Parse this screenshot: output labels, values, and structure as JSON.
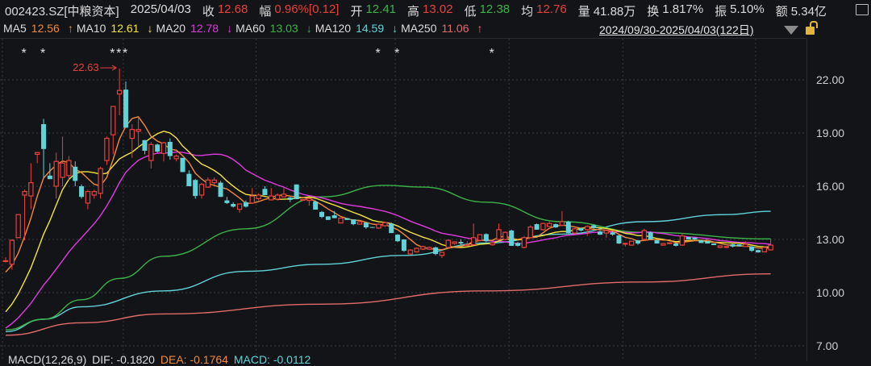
{
  "header": {
    "symbol": "002423.SZ[中粮资本]",
    "date": "2025/04/03",
    "fields": [
      {
        "label": "收",
        "value": "12.68",
        "color": "red"
      },
      {
        "label": "幅",
        "value": "0.96%[0.12]",
        "color": "red"
      },
      {
        "label": "开",
        "value": "12.41",
        "color": "green"
      },
      {
        "label": "高",
        "value": "13.02",
        "color": "red"
      },
      {
        "label": "低",
        "value": "12.38",
        "color": "green"
      },
      {
        "label": "均",
        "value": "12.76",
        "color": "red"
      },
      {
        "label": "量",
        "value": "41.88万",
        "color": "white"
      },
      {
        "label": "换",
        "value": "1.817%",
        "color": "white"
      },
      {
        "label": "振",
        "value": "5.10%",
        "color": "white"
      },
      {
        "label": "额",
        "value": "5.34亿",
        "color": "white"
      }
    ]
  },
  "ma_legend": [
    {
      "label": "MA5",
      "value": "12.56",
      "arrow": "↑",
      "color": "#f08a3c",
      "arrow_color": "#f08a3c"
    },
    {
      "label": "MA10",
      "value": "12.61",
      "arrow": "↓",
      "color": "#f2e43a",
      "arrow_color": "#f2e43a"
    },
    {
      "label": "MA20",
      "value": "12.78",
      "arrow": "↓",
      "color": "#e03ae0",
      "arrow_color": "#e03ae0"
    },
    {
      "label": "MA60",
      "value": "13.03",
      "arrow": "↓",
      "color": "#3cb34a",
      "arrow_color": "#3cb34a"
    },
    {
      "label": "MA120",
      "value": "14.59",
      "arrow": "↓",
      "color": "#5fd3d8",
      "arrow_color": "#5fd3d8"
    },
    {
      "label": "MA250",
      "value": "11.06",
      "arrow": "↑",
      "color": "#e26b6b",
      "arrow_color": "#e26b6b"
    }
  ],
  "date_range": "2024/09/30-2025/04/03(122日)",
  "icons": {
    "dropdown": "triangle-down-icon",
    "lock": "lock-icon",
    "monitor": "monitor-icon"
  },
  "colors": {
    "up": "#e8413b",
    "down": "#5fd3d8",
    "background": "#131418",
    "grid": "#3a3b40",
    "axis_text": "#cfcfcf"
  },
  "macd": {
    "label": "MACD(12,26,9)",
    "dif": "DIF: -0.1820",
    "dea": "DEA: -0.1764",
    "macd": "MACD: -0.0112"
  },
  "chart_data": {
    "type": "candlestick",
    "ylim": [
      7,
      23.5
    ],
    "yticks": [
      "22.00",
      "19.00",
      "16.00",
      "13.00",
      "10.00",
      "7.00"
    ],
    "ytick_values": [
      22,
      19,
      16,
      13,
      10,
      7
    ],
    "max_label": "22.63",
    "max_index": 18,
    "marker_indices": [
      3,
      6,
      17,
      18,
      19,
      59,
      62,
      77
    ],
    "marker_symbol": "*",
    "month_boundary_indices": [
      19,
      40,
      62,
      80,
      98,
      119
    ],
    "ohlc": [
      [
        11.8,
        12.0,
        11.7,
        11.8
      ],
      [
        11.6,
        13.0,
        11.3,
        12.95
      ],
      [
        13.1,
        14.4,
        13.1,
        14.4
      ],
      [
        15.5,
        15.8,
        12.95,
        15.7
      ],
      [
        15.45,
        17.3,
        14.7,
        16.2
      ],
      [
        17.8,
        17.9,
        17.3,
        17.9
      ],
      [
        19.5,
        19.8,
        16.5,
        18.1
      ],
      [
        16.6,
        17.3,
        16.4,
        16.4
      ],
      [
        16.0,
        17.9,
        15.3,
        17.4
      ],
      [
        16.5,
        18.8,
        16.0,
        17.3
      ],
      [
        16.6,
        17.7,
        16.3,
        17.45
      ],
      [
        17.1,
        17.4,
        16.0,
        16.3
      ],
      [
        16.0,
        16.1,
        15.3,
        15.4
      ],
      [
        15.05,
        15.8,
        14.7,
        15.7
      ],
      [
        15.5,
        15.8,
        15.3,
        15.7
      ],
      [
        15.6,
        17.1,
        15.3,
        17.0
      ],
      [
        17.45,
        18.8,
        17.2,
        18.7
      ],
      [
        18.9,
        20.5,
        17.8,
        20.5
      ],
      [
        21.2,
        22.63,
        20.0,
        21.4
      ],
      [
        21.45,
        21.9,
        19.3,
        19.3
      ],
      [
        18.7,
        19.5,
        17.6,
        19.2
      ],
      [
        19.1,
        19.9,
        18.2,
        19.2
      ],
      [
        18.6,
        18.6,
        17.8,
        18.0
      ],
      [
        17.45,
        18.5,
        17.0,
        18.35
      ],
      [
        18.35,
        18.4,
        17.9,
        17.95
      ],
      [
        17.85,
        18.5,
        17.4,
        18.45
      ],
      [
        18.5,
        18.7,
        17.5,
        17.7
      ],
      [
        17.55,
        17.8,
        17.4,
        17.7
      ],
      [
        17.6,
        17.6,
        16.8,
        16.8
      ],
      [
        16.7,
        16.9,
        16.0,
        16.0
      ],
      [
        16.35,
        16.4,
        15.3,
        15.45
      ],
      [
        15.5,
        16.2,
        15.3,
        16.1
      ],
      [
        15.95,
        16.5,
        15.9,
        16.35
      ],
      [
        16.2,
        16.5,
        16.1,
        16.35
      ],
      [
        16.2,
        16.3,
        15.4,
        15.4
      ],
      [
        15.2,
        15.4,
        15.0,
        15.05
      ],
      [
        15.0,
        15.1,
        14.8,
        14.85
      ],
      [
        14.7,
        15.0,
        14.5,
        15.0
      ],
      [
        15.1,
        15.2,
        14.8,
        14.85
      ],
      [
        15.05,
        15.9,
        15.0,
        15.45
      ],
      [
        15.3,
        15.6,
        15.2,
        15.5
      ],
      [
        15.85,
        16.0,
        15.5,
        15.5
      ],
      [
        15.23,
        15.9,
        15.2,
        15.45
      ],
      [
        15.27,
        15.6,
        15.2,
        15.5
      ],
      [
        15.4,
        15.9,
        15.4,
        15.55
      ],
      [
        15.36,
        15.4,
        15.1,
        15.23
      ],
      [
        16.1,
        16.1,
        15.27,
        15.27
      ],
      [
        15.23,
        15.25,
        15.2,
        15.25
      ],
      [
        15.2,
        15.3,
        14.9,
        15.3
      ],
      [
        15.14,
        15.2,
        14.68,
        14.68
      ],
      [
        14.55,
        14.6,
        14.2,
        14.27
      ],
      [
        14.3,
        14.3,
        14.1,
        14.1
      ],
      [
        14.36,
        14.6,
        14.2,
        14.2
      ],
      [
        13.93,
        14.2,
        13.93,
        14.2
      ],
      [
        14.2,
        14.2,
        14.1,
        14.1
      ],
      [
        14.13,
        14.13,
        13.8,
        13.86
      ],
      [
        13.86,
        14.0,
        13.86,
        14.0
      ],
      [
        13.95,
        13.95,
        13.6,
        13.68
      ],
      [
        13.7,
        13.7,
        13.65,
        13.68
      ],
      [
        13.64,
        13.9,
        13.6,
        13.86
      ],
      [
        13.77,
        14.0,
        13.7,
        13.95
      ],
      [
        13.9,
        13.95,
        13.36,
        13.36
      ],
      [
        13.27,
        13.3,
        12.85,
        12.9
      ],
      [
        13.0,
        13.0,
        12.3,
        12.36
      ],
      [
        12.18,
        12.45,
        12.15,
        12.4
      ],
      [
        12.3,
        12.55,
        12.25,
        12.5
      ],
      [
        12.45,
        12.65,
        12.4,
        12.6
      ],
      [
        12.45,
        12.6,
        12.4,
        12.55
      ],
      [
        12.55,
        12.6,
        12.1,
        12.18
      ],
      [
        12.1,
        12.3,
        11.95,
        12.27
      ],
      [
        12.55,
        13.0,
        12.5,
        12.95
      ],
      [
        12.77,
        12.9,
        12.7,
        12.86
      ],
      [
        12.86,
        13.0,
        12.7,
        12.77
      ],
      [
        12.68,
        12.9,
        12.6,
        12.7
      ],
      [
        12.7,
        13.9,
        12.65,
        13.1
      ],
      [
        12.95,
        13.3,
        12.9,
        13.27
      ],
      [
        13.3,
        13.35,
        12.85,
        12.9
      ],
      [
        12.7,
        12.85,
        12.65,
        12.8
      ],
      [
        13.0,
        13.9,
        12.95,
        13.55
      ],
      [
        13.0,
        13.45,
        12.95,
        13.4
      ],
      [
        13.5,
        13.55,
        12.64,
        12.64
      ],
      [
        12.8,
        12.85,
        12.6,
        12.64
      ],
      [
        12.55,
        13.2,
        12.5,
        13.1
      ],
      [
        13.1,
        13.8,
        13.05,
        13.7
      ],
      [
        13.86,
        13.9,
        13.55,
        13.55
      ],
      [
        13.55,
        13.95,
        13.5,
        13.9
      ],
      [
        13.73,
        14.0,
        13.7,
        13.9
      ],
      [
        13.86,
        13.9,
        13.65,
        13.68
      ],
      [
        13.8,
        14.6,
        13.75,
        14.0
      ],
      [
        14.0,
        14.05,
        13.35,
        13.36
      ],
      [
        13.36,
        13.65,
        13.3,
        13.6
      ],
      [
        13.64,
        13.65,
        13.45,
        13.5
      ],
      [
        13.55,
        13.8,
        13.2,
        13.73
      ],
      [
        13.8,
        13.85,
        13.6,
        13.64
      ],
      [
        13.45,
        13.5,
        13.25,
        13.27
      ],
      [
        13.36,
        13.55,
        13.1,
        13.5
      ],
      [
        13.4,
        13.45,
        13.2,
        13.27
      ],
      [
        13.23,
        13.25,
        12.75,
        12.77
      ],
      [
        12.77,
        12.8,
        12.6,
        12.78
      ],
      [
        12.68,
        12.9,
        12.65,
        12.9
      ],
      [
        12.95,
        12.95,
        12.7,
        12.77
      ],
      [
        13.0,
        13.6,
        12.95,
        13.5
      ],
      [
        13.4,
        13.45,
        13.0,
        13.0
      ],
      [
        12.95,
        12.95,
        12.77,
        12.77
      ],
      [
        12.68,
        12.8,
        12.65,
        12.77
      ],
      [
        12.8,
        12.82,
        12.78,
        12.81
      ],
      [
        12.77,
        12.77,
        12.6,
        12.64
      ],
      [
        12.68,
        13.35,
        12.65,
        13.2
      ],
      [
        13.14,
        13.15,
        13.0,
        13.0
      ],
      [
        13.1,
        13.12,
        12.98,
        13.0
      ],
      [
        12.95,
        12.95,
        12.8,
        12.8
      ],
      [
        12.9,
        12.9,
        12.77,
        12.77
      ],
      [
        12.77,
        12.78,
        12.68,
        12.68
      ],
      [
        12.55,
        12.66,
        12.5,
        12.64
      ],
      [
        12.55,
        12.62,
        12.5,
        12.6
      ],
      [
        12.73,
        12.75,
        12.55,
        12.6
      ],
      [
        12.72,
        12.74,
        12.6,
        12.62
      ],
      [
        12.6,
        12.9,
        12.58,
        12.73
      ],
      [
        12.6,
        12.62,
        12.3,
        12.36
      ],
      [
        12.4,
        12.42,
        12.25,
        12.27
      ],
      [
        12.3,
        12.6,
        12.28,
        12.55
      ],
      [
        12.41,
        13.02,
        12.38,
        12.68
      ]
    ],
    "ma_start": {
      "MA5": 11.0,
      "MA10": 8.6,
      "MA20": 7.8
    },
    "ma_long": {
      "MA60": [
        [
          0,
          7.9
        ],
        [
          6,
          8.5
        ],
        [
          12,
          9.6
        ],
        [
          18,
          10.8
        ],
        [
          25,
          12.05
        ],
        [
          38,
          13.6
        ],
        [
          50,
          15.4
        ],
        [
          60,
          16.05
        ],
        [
          66,
          15.95
        ],
        [
          76,
          15.1
        ],
        [
          88,
          14.0
        ],
        [
          101,
          13.4
        ],
        [
          121,
          13.03
        ]
      ],
      "MA120": [
        [
          0,
          7.8
        ],
        [
          6,
          8.5
        ],
        [
          12,
          9.2
        ],
        [
          25,
          10.1
        ],
        [
          38,
          11.2
        ],
        [
          50,
          11.6
        ],
        [
          63,
          12.1
        ],
        [
          76,
          12.8
        ],
        [
          88,
          13.3
        ],
        [
          101,
          14.0
        ],
        [
          114,
          14.4
        ],
        [
          121,
          14.59
        ]
      ],
      "MA250": [
        [
          0,
          7.6
        ],
        [
          12,
          8.3
        ],
        [
          25,
          8.8
        ],
        [
          50,
          9.35
        ],
        [
          76,
          10.1
        ],
        [
          101,
          10.6
        ],
        [
          121,
          11.06
        ]
      ]
    }
  }
}
